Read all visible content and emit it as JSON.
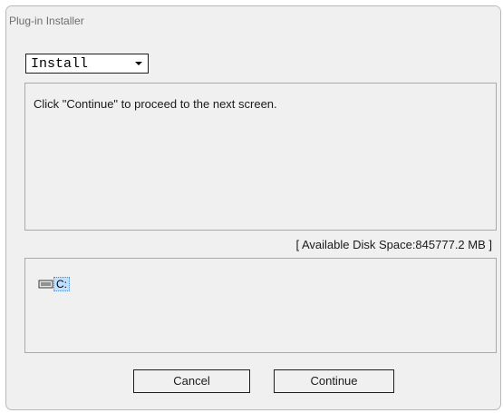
{
  "window": {
    "title": "Plug-in Installer"
  },
  "mode_select": {
    "selected": "Install"
  },
  "message": {
    "text": "Click \"Continue\" to proceed to the next screen."
  },
  "disk": {
    "available_text": "[ Available Disk Space:845777.2 MB ]"
  },
  "drives": [
    {
      "label": "C:",
      "icon": "drive-icon",
      "selected": true
    }
  ],
  "buttons": {
    "cancel_label": "Cancel",
    "continue_label": "Continue"
  },
  "colors": {
    "window_bg": "#f0f0f0",
    "selection_bg": "#bfe1ff",
    "border": "#1e1e1e"
  }
}
